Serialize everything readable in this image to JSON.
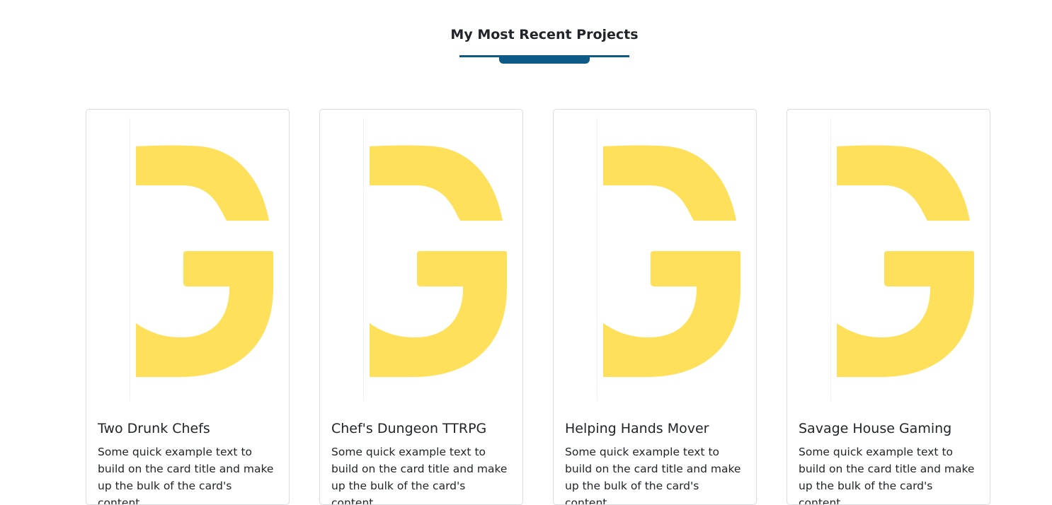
{
  "section": {
    "title": "My Most Recent Projects"
  },
  "colors": {
    "accent": "#0d5a87",
    "logo": "#ffe05a",
    "card_border": "#d9dcdf"
  },
  "cards": [
    {
      "title": "Two Drunk Chefs",
      "text": "Some quick example text to build on the card title and make up the bulk of the card's content.",
      "image_icon": "g-logo-icon"
    },
    {
      "title": "Chef's Dungeon TTRPG",
      "text": "Some quick example text to build on the card title and make up the bulk of the card's content.",
      "image_icon": "g-logo-icon"
    },
    {
      "title": "Helping Hands Mover",
      "text": "Some quick example text to build on the card title and make up the bulk of the card's content.",
      "image_icon": "g-logo-icon"
    },
    {
      "title": "Savage House Gaming",
      "text": "Some quick example text to build on the card title and make up the bulk of the card's content.",
      "image_icon": "g-logo-icon"
    }
  ]
}
